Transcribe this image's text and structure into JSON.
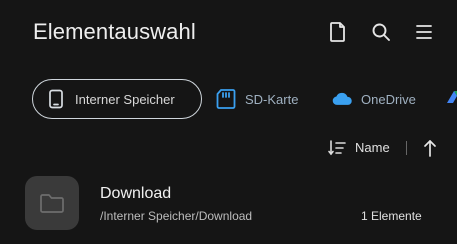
{
  "header": {
    "title": "Elementauswahl",
    "icons": [
      "new-file-icon",
      "search-icon",
      "menu-icon"
    ]
  },
  "storage": {
    "items": [
      {
        "label": "Interner Speicher",
        "icon": "phone-icon",
        "selected": true
      },
      {
        "label": "SD-Karte",
        "icon": "sd-card-icon",
        "selected": false
      },
      {
        "label": "OneDrive",
        "icon": "cloud-icon",
        "selected": false
      },
      {
        "label": "",
        "icon": "drive-icon",
        "selected": false
      }
    ]
  },
  "sort": {
    "label": "Name",
    "icon": "sort-icon",
    "direction_icon": "arrow-up-icon"
  },
  "list": {
    "items": [
      {
        "name": "Download",
        "path": "/Interner Speicher/Download",
        "count": "1 Elemente",
        "icon": "folder-icon"
      }
    ]
  },
  "colors": {
    "background": "#151515",
    "chip_border": "#cfd6dc",
    "accent_blue": "#3aa0f0",
    "folder_tile": "#3a3a3a"
  }
}
